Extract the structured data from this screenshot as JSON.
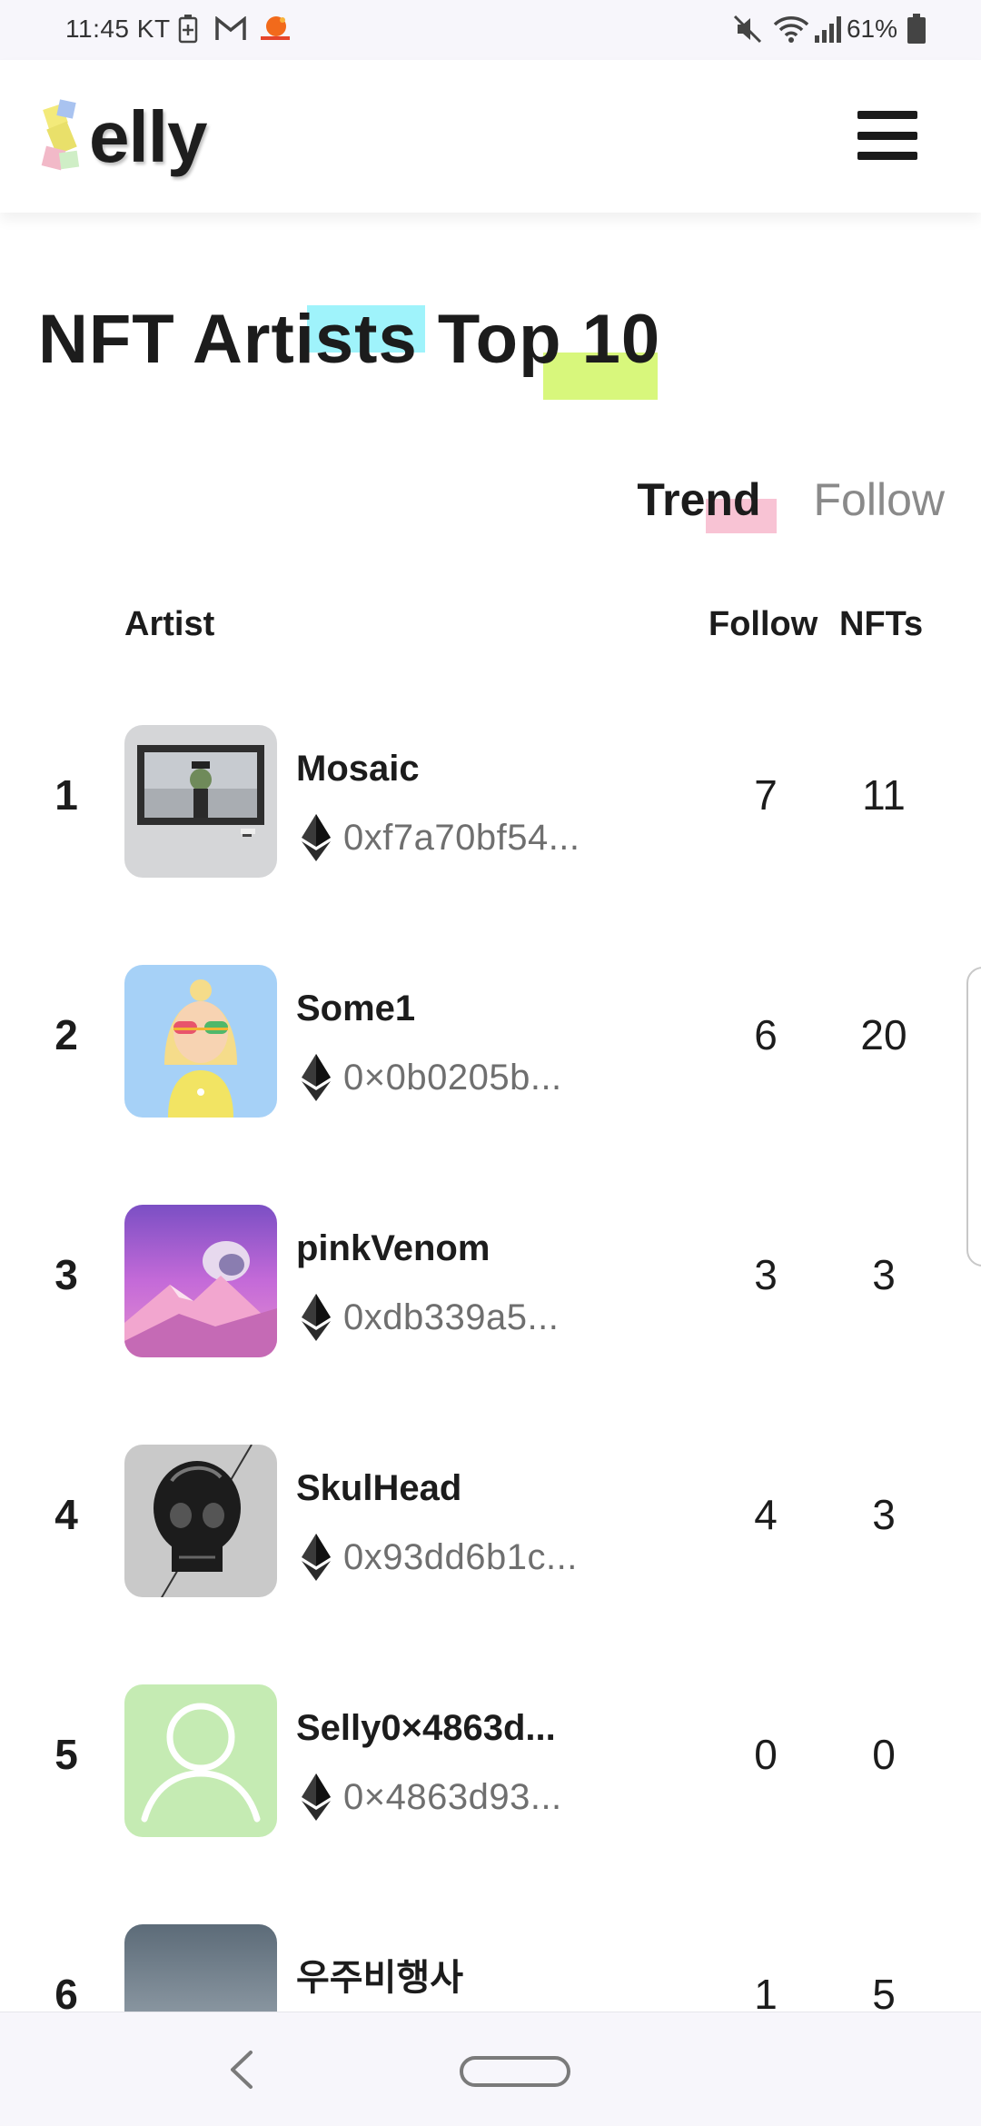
{
  "status_bar": {
    "time": "11:45 KT",
    "battery": "61%",
    "icons": [
      "battery-plus-icon",
      "gmail-icon",
      "app-notification-icon",
      "mute-icon",
      "wifi-icon",
      "signal-icon",
      "battery-icon"
    ]
  },
  "header": {
    "logo": "elly",
    "menu_icon": "hamburger-menu-icon"
  },
  "page": {
    "title": "NFT Artists Top 10",
    "highlight_colors": [
      "#9ff3fb",
      "#d8f77c",
      "#f7b9cc"
    ]
  },
  "tabs": [
    {
      "label": "Trend",
      "active": true
    },
    {
      "label": "Follow",
      "active": false
    }
  ],
  "table": {
    "headers": {
      "artist": "Artist",
      "follow": "Follow",
      "nfts": "NFTs"
    },
    "rows": [
      {
        "rank": "1",
        "name": "Mosaic",
        "address": "0xf7a70bf54...",
        "follow": "7",
        "nfts": "11",
        "avatar": "framed-painting"
      },
      {
        "rank": "2",
        "name": "Some1",
        "address": "0×0b0205b...",
        "follow": "6",
        "nfts": "20",
        "avatar": "blonde-character"
      },
      {
        "rank": "3",
        "name": "pinkVenom",
        "address": "0xdb339a5...",
        "follow": "3",
        "nfts": "3",
        "avatar": "pink-mountain"
      },
      {
        "rank": "4",
        "name": "SkulHead",
        "address": "0x93dd6b1c...",
        "follow": "4",
        "nfts": "3",
        "avatar": "black-skull"
      },
      {
        "rank": "5",
        "name": "Selly0×4863d...",
        "address": "0×4863d93...",
        "follow": "0",
        "nfts": "0",
        "avatar": "default-user"
      },
      {
        "rank": "6",
        "name": "우주비행사",
        "address": "",
        "follow": "1",
        "nfts": "5",
        "avatar": "astronaut"
      }
    ]
  },
  "nav": {
    "back_icon": "back-chevron-icon",
    "home_icon": "home-pill-icon"
  }
}
